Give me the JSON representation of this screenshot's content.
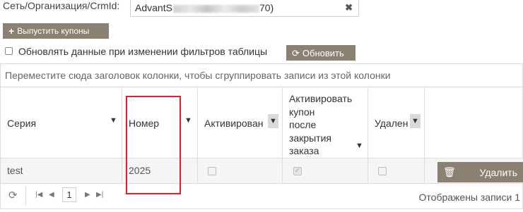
{
  "filter": {
    "label": "Сеть/Организация/CrmId:",
    "value_prefix": "AdvantS",
    "value_suffix": "70)",
    "clear_glyph": "✖"
  },
  "toolbar": {
    "issue_label": "Выпустить купоны",
    "issue_icon": "plus-icon",
    "auto_update_label": "Обновлять данные при изменении фильтров таблицы",
    "auto_update_checked": false,
    "refresh_label": "Обновить",
    "refresh_icon": "refresh-icon"
  },
  "grid": {
    "group_panel_text": "Переместите сюда заголовок колонки, чтобы сгруппировать записи из этой колонки",
    "columns": [
      "Серия",
      "Номер",
      "Активирован",
      "Активировать купон после закрытия заказа",
      "Удален"
    ],
    "header_activate_lines": [
      "Активировать",
      "купон",
      "после",
      "закрытия",
      "заказа"
    ],
    "rows": [
      {
        "series": "test",
        "number": "2025",
        "activated": false,
        "activate_after_close": true,
        "deleted": false,
        "delete_label": "Удалить"
      }
    ],
    "pager": {
      "page": "1",
      "info": "Отображены записи 1"
    }
  },
  "colors": {
    "button_bg": "#8b8172",
    "highlight": "#e0202a"
  }
}
